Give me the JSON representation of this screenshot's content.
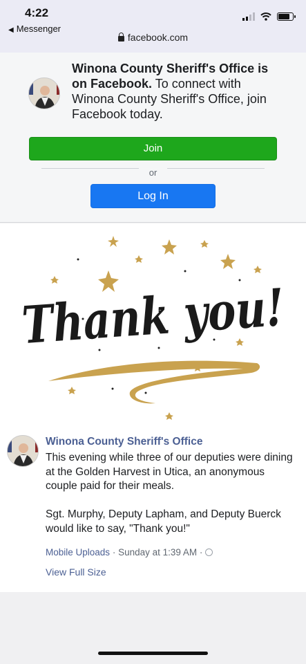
{
  "status_bar": {
    "time": "4:22",
    "back_label": "Messenger",
    "url": "facebook.com"
  },
  "promo": {
    "page_name": "Winona County Sheriff's Office",
    "is_on": " is on Facebook.",
    "connect_text": " To connect with Winona County Sheriff's Office, join Facebook today.",
    "join_label": "Join",
    "or_label": "or",
    "login_label": "Log In"
  },
  "post": {
    "image_text": "Thank you!",
    "author": "Winona County Sheriff's Office",
    "body": "This evening while three of our deputies were dining at the Golden Harvest in Utica, an anonymous couple paid for their meals.\n\nSgt. Murphy, Deputy Lapham, and Deputy Buerck would like to say, \"Thank you!\"",
    "album": "Mobile Uploads",
    "separator": " · ",
    "time": "Sunday at 1:39 AM",
    "view_full_size": "View Full Size"
  },
  "colors": {
    "join_green": "#1ea71c",
    "login_blue": "#1877f2",
    "link_blue": "#4b5f93",
    "gold": "#c9a24f"
  },
  "icons": [
    "back-arrow-icon",
    "lock-icon",
    "cellular-signal-icon",
    "wifi-icon",
    "battery-icon",
    "globe-icon"
  ]
}
